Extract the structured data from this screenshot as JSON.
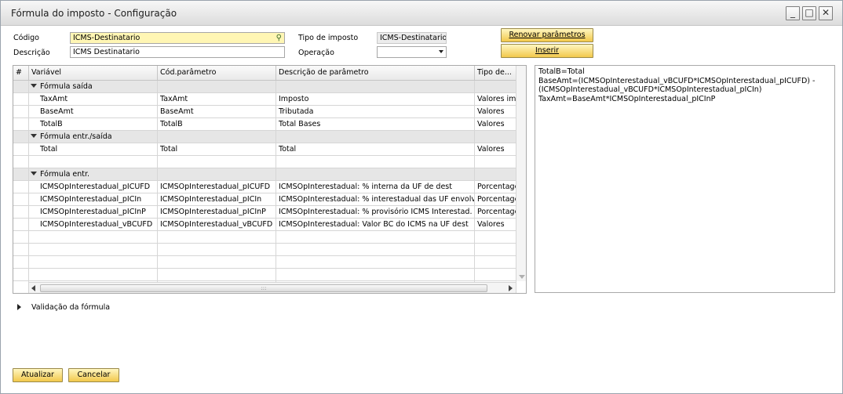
{
  "window": {
    "title": "Fórmula do imposto - Configuração"
  },
  "form": {
    "codigo_label": "Código",
    "codigo_value": "ICMS-Destinatario",
    "descricao_label": "Descrição",
    "descricao_value": "ICMS Destinatario",
    "tipo_label": "Tipo de imposto",
    "tipo_value": "ICMS-Destinatario",
    "operacao_label": "Operação",
    "operacao_value": ""
  },
  "buttons": {
    "renovar": "Renovar parâmetros",
    "inserir": "Inserir",
    "atualizar": "Atualizar",
    "cancelar": "Cancelar"
  },
  "grid": {
    "headers": [
      "#",
      "Variável",
      "Cód.parâmetro",
      "Descrição de parâmetro",
      "Tipo de..."
    ],
    "groups": [
      {
        "label": "Fórmula saída",
        "rows": [
          [
            "TaxAmt",
            "TaxAmt",
            "Imposto",
            "Valores imp"
          ],
          [
            "BaseAmt",
            "BaseAmt",
            "Tributada",
            "Valores"
          ],
          [
            "TotalB",
            "TotalB",
            "Total Bases",
            "Valores"
          ]
        ]
      },
      {
        "label": "Fórmula entr./saída",
        "rows": [
          [
            "Total",
            "Total",
            "Total",
            "Valores"
          ],
          [
            "",
            "",
            "",
            ""
          ]
        ]
      },
      {
        "label": "Fórmula entr.",
        "rows": [
          [
            "ICMSOpInterestadual_pICUFD",
            "ICMSOpInterestadual_pICUFD",
            "ICMSOpInterestadual: % interna da UF de dest",
            "Porcentage"
          ],
          [
            "ICMSOpInterestadual_pICIn",
            "ICMSOpInterestadual_pICIn",
            "ICMSOpInterestadual: % interestadual das UF envolvi",
            "Porcentage"
          ],
          [
            "ICMSOpInterestadual_pICInP",
            "ICMSOpInterestadual_pICInP",
            "ICMSOpInterestadual: % provisório ICMS Interestad.",
            "Porcentage"
          ],
          [
            "ICMSOpInterestadual_vBCUFD",
            "ICMSOpInterestadual_vBCUFD",
            "ICMSOpInterestadual: Valor BC do ICMS na UF dest",
            "Valores"
          ]
        ]
      }
    ]
  },
  "formula_text": [
    "TotalB=Total",
    "BaseAmt=(ICMSOpInterestadual_vBCUFD*ICMSOpInterestadual_pICUFD) -",
    "(ICMSOpInterestadual_vBCUFD*ICMSOpInterestadual_pICIn)",
    "TaxAmt=BaseAmt*ICMSOpInterestadual_pICInP"
  ],
  "validation_label": "Validação da fórmula",
  "icons": {
    "lookup": "lookup-icon",
    "expand": "expand-icon",
    "dropdown": "chevron-down-icon"
  }
}
